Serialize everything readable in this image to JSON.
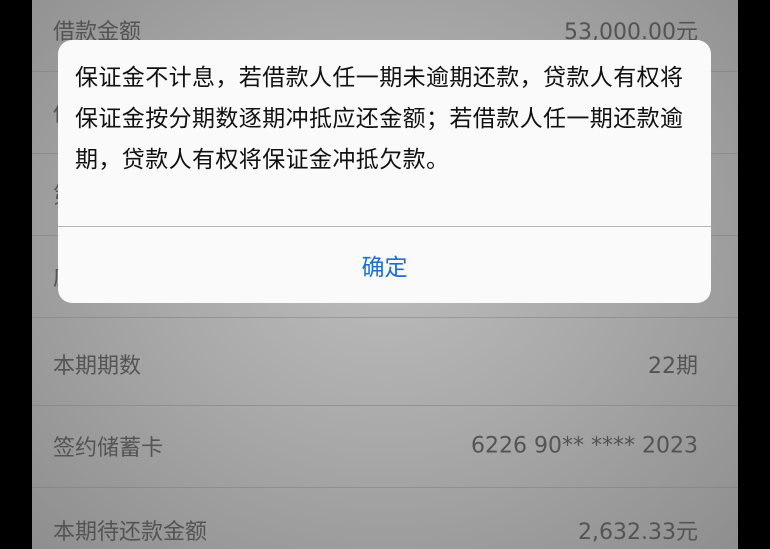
{
  "rows": [
    {
      "label": "借款金额",
      "value": "53,000.00元"
    },
    {
      "label": "借",
      "value": ""
    },
    {
      "label": "第",
      "value": ""
    },
    {
      "label": "应",
      "value": ""
    },
    {
      "label": "本期期数",
      "value": "22期"
    },
    {
      "label": "签约储蓄卡",
      "value": "6226 90** **** 2023"
    },
    {
      "label": "本期待还款金额",
      "value": "2,632.33元"
    }
  ],
  "alert": {
    "message": "保证金不计息，若借款人任一期未逾期还款，贷款人有权将保证金按分期数逐期冲抵应还金额；若借款人任一期还款逾期，贷款人有权将保证金冲抵欠款。",
    "confirm_label": "确定"
  },
  "colors": {
    "confirm_text": "#1a6fd0",
    "backdrop": "#a9a9a9"
  }
}
